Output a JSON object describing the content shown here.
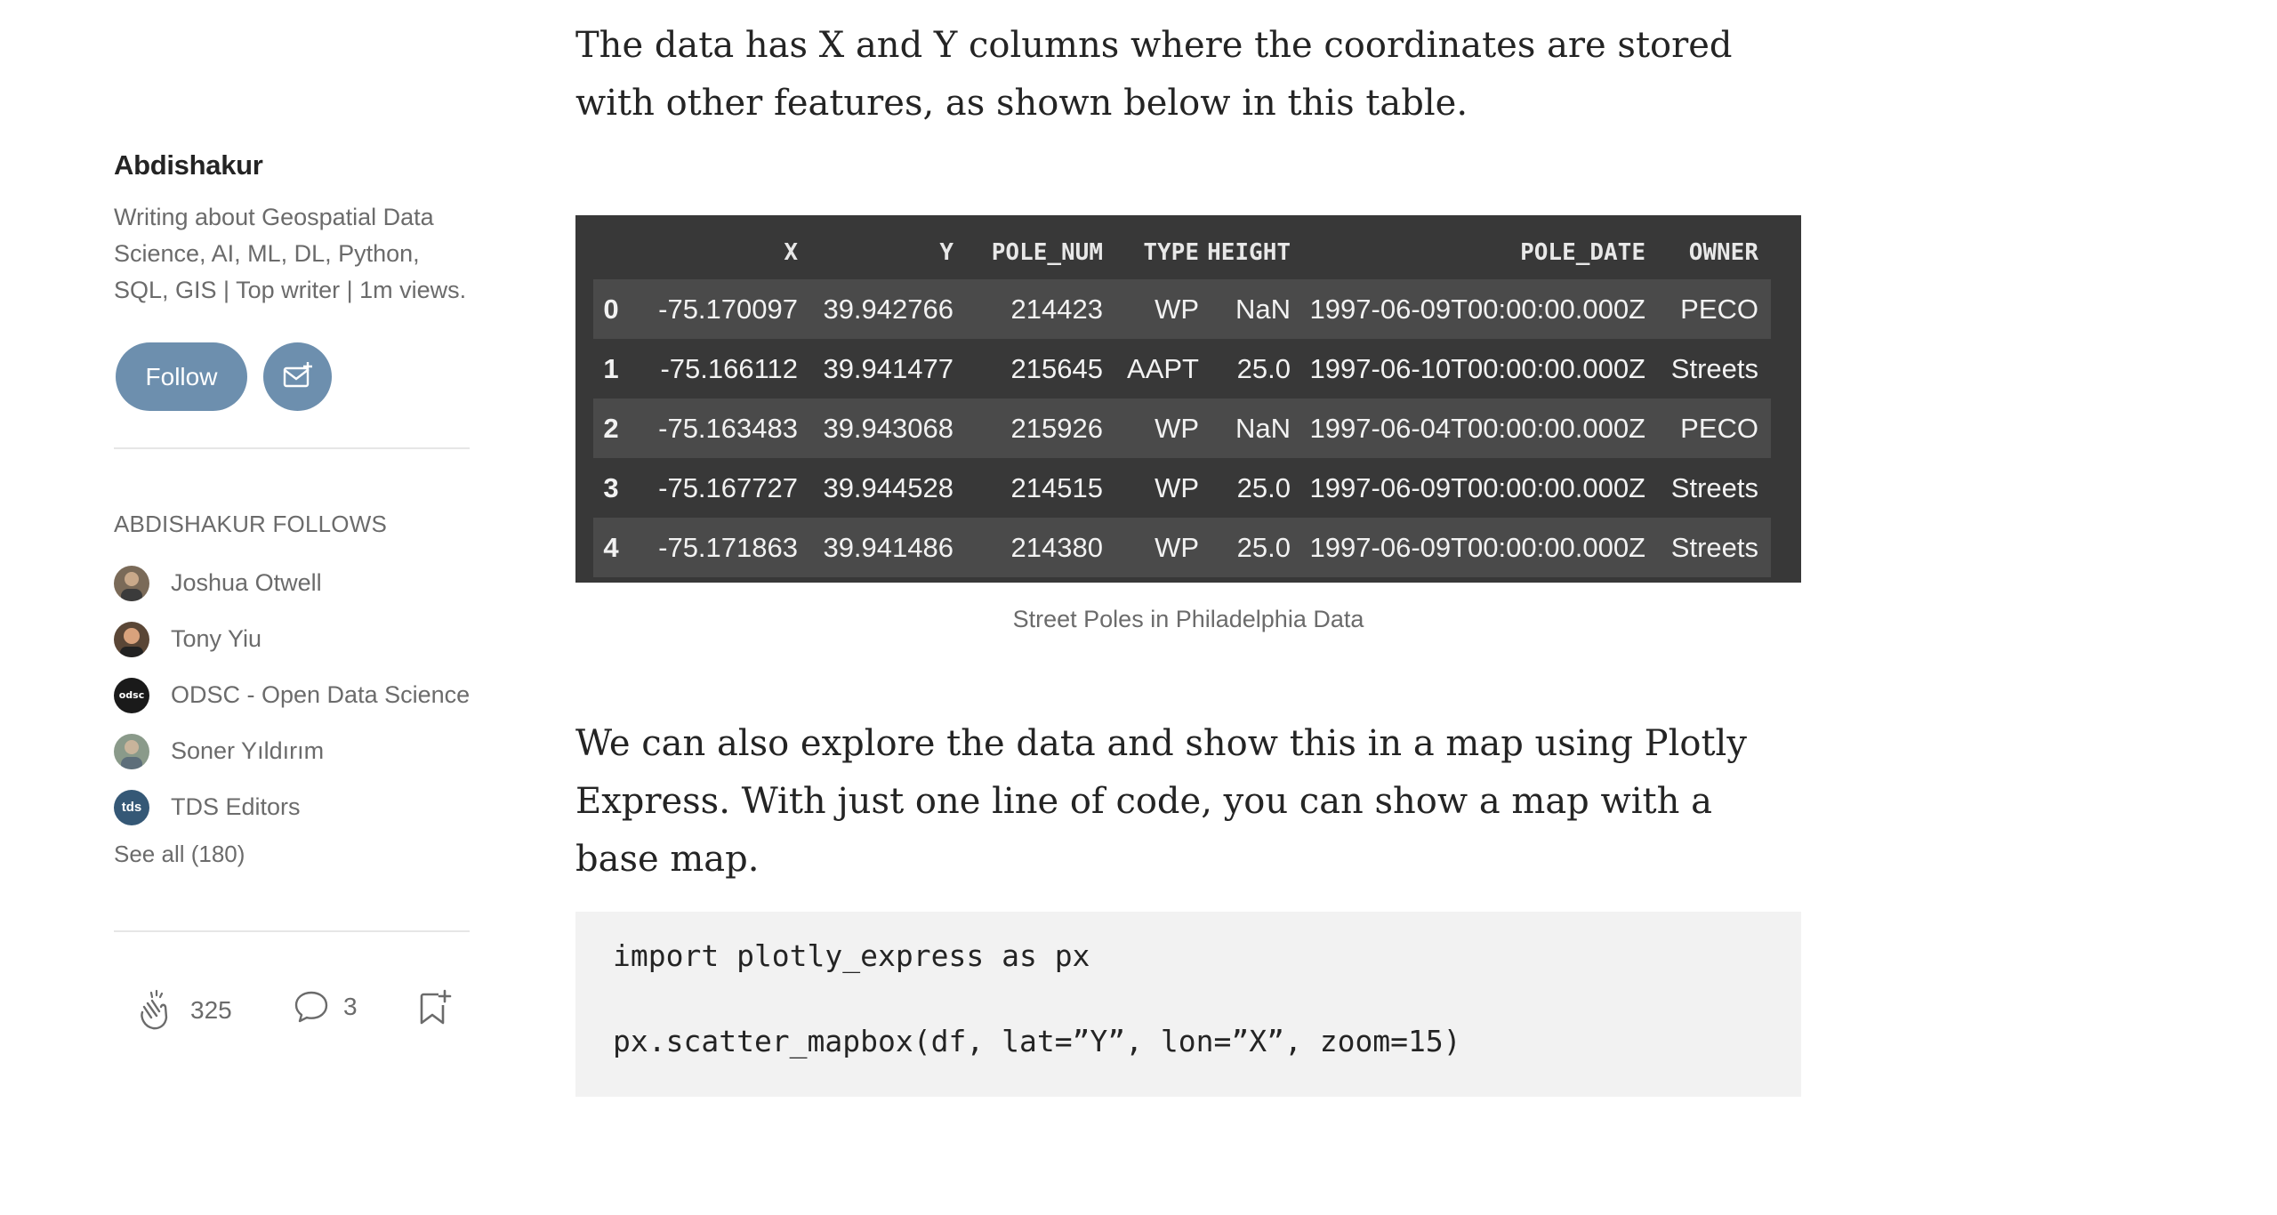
{
  "sidebar": {
    "author_name": "Abdishakur",
    "bio": "Writing about Geospatial Data Science, AI, ML, DL, Python, SQL, GIS | Top writer | 1m views.",
    "follow_label": "Follow",
    "follows_heading": "ABDISHAKUR FOLLOWS",
    "follows": [
      {
        "name": "Joshua Otwell",
        "avatar_color": "#7a6a58"
      },
      {
        "name": "Tony Yiu",
        "avatar_color": "#5a4636"
      },
      {
        "name": "ODSC - Open Data Science",
        "avatar_color": "#1a1a1a",
        "avatar_text": "odsc"
      },
      {
        "name": "Soner Yıldırım",
        "avatar_color": "#8a9a8a"
      },
      {
        "name": "TDS Editors",
        "avatar_color": "#355876",
        "avatar_text": "tds"
      }
    ],
    "see_all": "See all (180)",
    "claps": "325",
    "responses": "3"
  },
  "article": {
    "para1": "The data has X and Y columns where the coordinates are stored with other features, as shown below in this table.",
    "table": {
      "headers": [
        "",
        "X",
        "Y",
        "POLE_NUM",
        "TYPE",
        "HEIGHT",
        "POLE_DATE",
        "OWNER"
      ],
      "rows": [
        [
          "0",
          "-75.170097",
          "39.942766",
          "214423",
          "WP",
          "NaN",
          "1997-06-09T00:00:00.000Z",
          "PECO"
        ],
        [
          "1",
          "-75.166112",
          "39.941477",
          "215645",
          "AAPT",
          "25.0",
          "1997-06-10T00:00:00.000Z",
          "Streets"
        ],
        [
          "2",
          "-75.163483",
          "39.943068",
          "215926",
          "WP",
          "NaN",
          "1997-06-04T00:00:00.000Z",
          "PECO"
        ],
        [
          "3",
          "-75.167727",
          "39.944528",
          "214515",
          "WP",
          "25.0",
          "1997-06-09T00:00:00.000Z",
          "Streets"
        ],
        [
          "4",
          "-75.171863",
          "39.941486",
          "214380",
          "WP",
          "25.0",
          "1997-06-09T00:00:00.000Z",
          "Streets"
        ]
      ]
    },
    "caption": "Street Poles in Philadelphia Data",
    "para2": "We can also explore the data and show this in a map using Plotly Express. With just one line of code, you can show a map with a base map.",
    "code": {
      "line1": "import plotly_express as px",
      "line2": "px.scatter_mapbox(df, lat=”Y”, lon=”X”, zoom=15)"
    }
  }
}
